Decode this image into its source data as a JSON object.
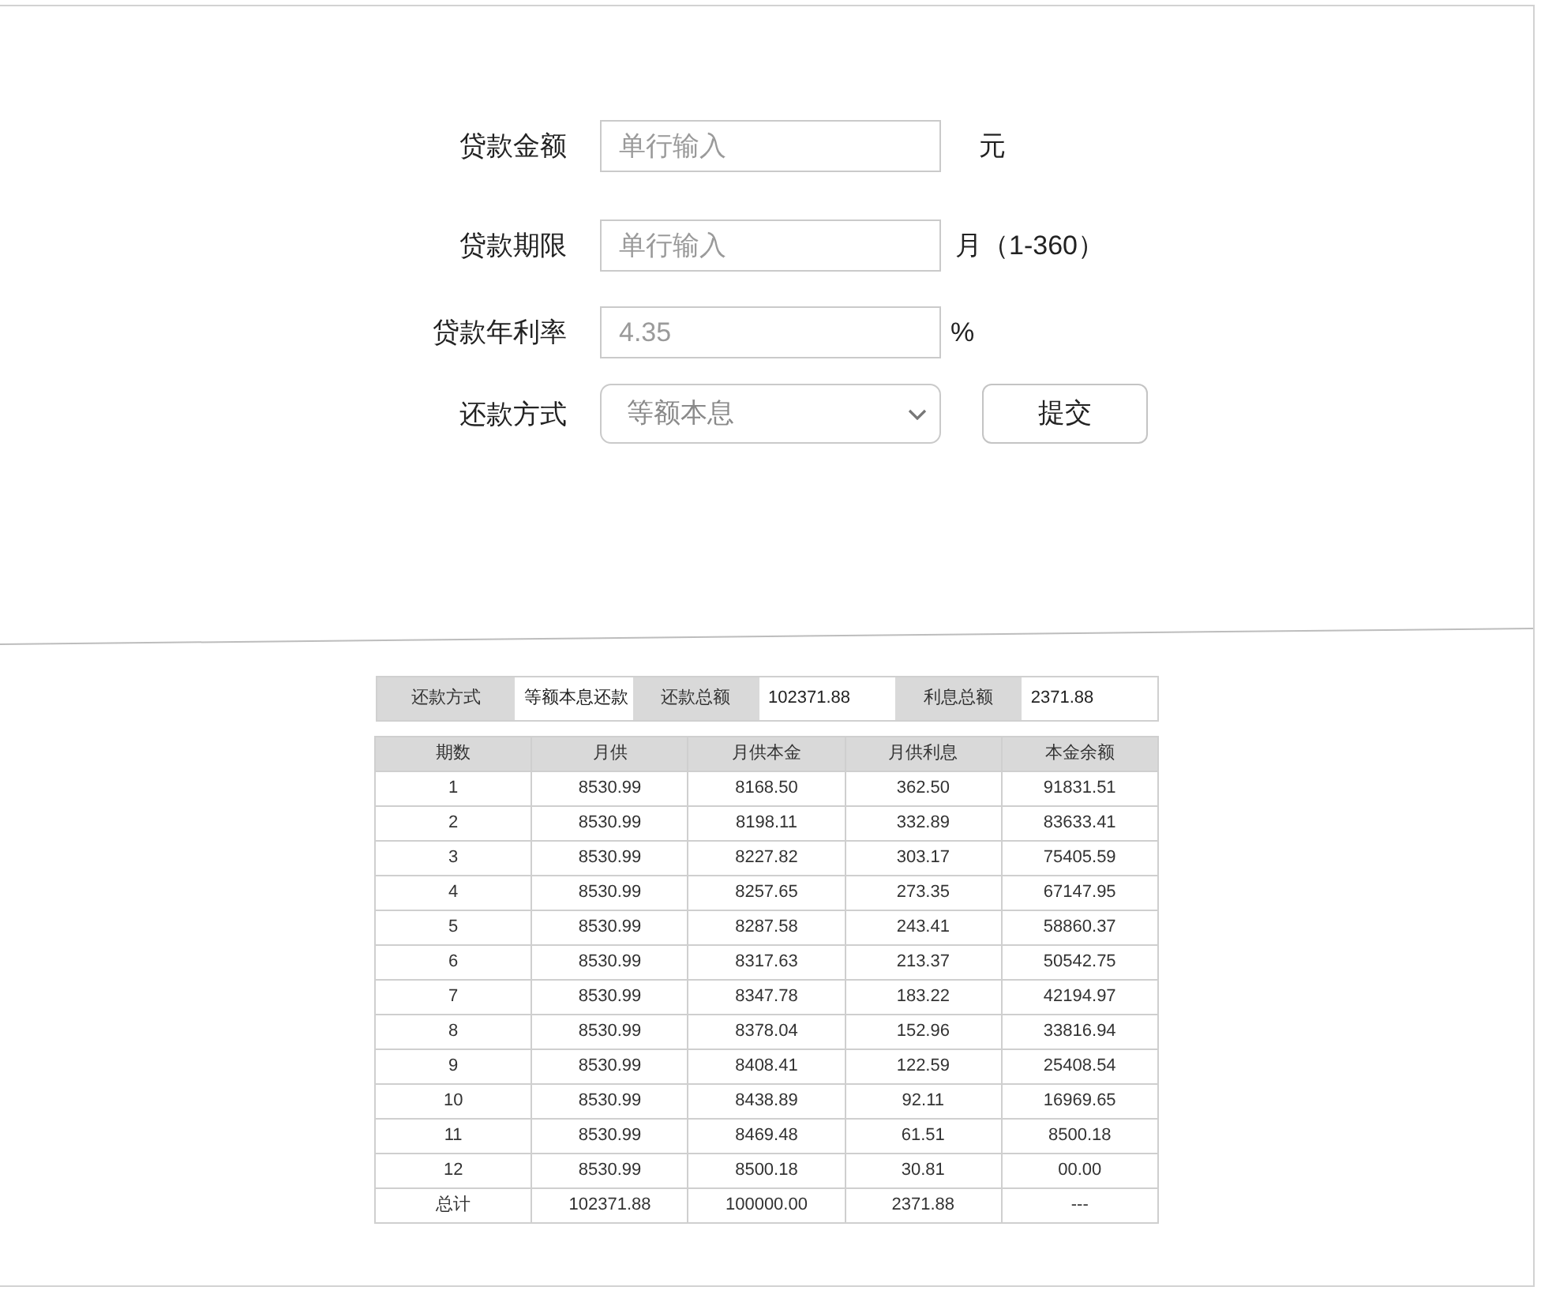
{
  "form": {
    "fields": [
      {
        "kind": "input",
        "label": "贷款金额",
        "placeholder": "单行输入",
        "unit": "元"
      },
      {
        "kind": "input",
        "label": "贷款期限",
        "placeholder": "单行输入",
        "unit": "月（1-360）"
      },
      {
        "kind": "input",
        "label": "贷款年利率",
        "placeholder": "4.35",
        "unit": "%"
      },
      {
        "kind": "select",
        "label": "还款方式",
        "placeholder": "等额本息"
      }
    ],
    "submit_button": "提交"
  },
  "summary": [
    {
      "label": "还款方式",
      "value": "等额本息还款"
    },
    {
      "label": "还款总额",
      "value": "102371.88"
    },
    {
      "label": "利息总额",
      "value": "2371.88"
    }
  ],
  "table": {
    "columns": [
      "期数",
      "月供",
      "月供本金",
      "月供利息",
      "本金余额"
    ],
    "rows": [
      [
        "1",
        "8530.99",
        "8168.50",
        "362.50",
        "91831.51"
      ],
      [
        "2",
        "8530.99",
        "8198.11",
        "332.89",
        "83633.41"
      ],
      [
        "3",
        "8530.99",
        "8227.82",
        "303.17",
        "75405.59"
      ],
      [
        "4",
        "8530.99",
        "8257.65",
        "273.35",
        "67147.95"
      ],
      [
        "5",
        "8530.99",
        "8287.58",
        "243.41",
        "58860.37"
      ],
      [
        "6",
        "8530.99",
        "8317.63",
        "213.37",
        "50542.75"
      ],
      [
        "7",
        "8530.99",
        "8347.78",
        "183.22",
        "42194.97"
      ],
      [
        "8",
        "8530.99",
        "8378.04",
        "152.96",
        "33816.94"
      ],
      [
        "9",
        "8530.99",
        "8408.41",
        "122.59",
        "25408.54"
      ],
      [
        "10",
        "8530.99",
        "8438.89",
        "92.11",
        "16969.65"
      ],
      [
        "11",
        "8530.99",
        "8469.48",
        "61.51",
        "8500.18"
      ],
      [
        "12",
        "8530.99",
        "8500.18",
        "30.81",
        "00.00"
      ],
      [
        "总计",
        "102371.88",
        "100000.00",
        "2371.88",
        "---"
      ]
    ]
  }
}
